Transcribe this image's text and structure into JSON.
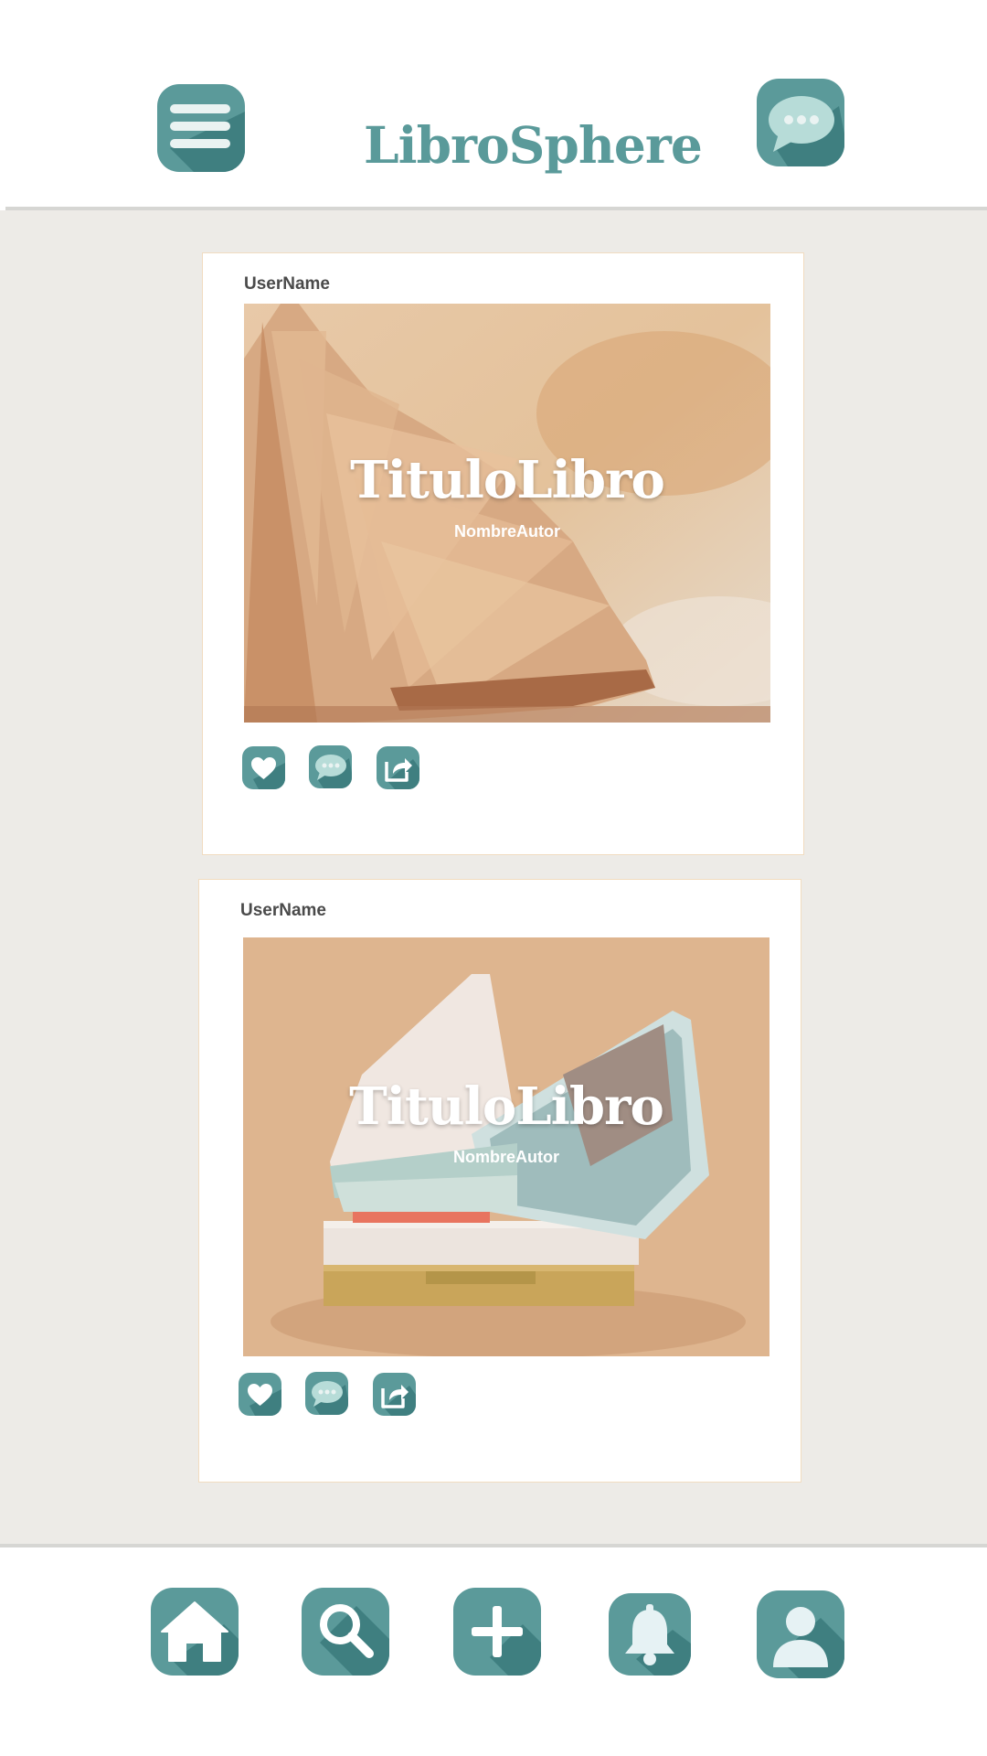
{
  "app": {
    "title": "LibroSphere"
  },
  "colors": {
    "brand": "#5b9a9a",
    "feed_bg": "#edebe7",
    "card_border": "#f1dcc0"
  },
  "header": {
    "menu_icon": "menu-icon",
    "chat_icon": "chat-bubble-icon"
  },
  "posts": [
    {
      "username": "UserName",
      "book_title": "TituloLibro",
      "author": "NombreAutor",
      "actions": [
        "heart-icon",
        "comment-icon",
        "share-icon"
      ]
    },
    {
      "username": "UserName",
      "book_title": "TituloLibro",
      "author": "NombreAutor",
      "actions": [
        "heart-icon",
        "comment-icon",
        "share-icon"
      ]
    }
  ],
  "nav": {
    "items": [
      "home-icon",
      "search-icon",
      "add-icon",
      "bell-icon",
      "profile-icon"
    ]
  }
}
